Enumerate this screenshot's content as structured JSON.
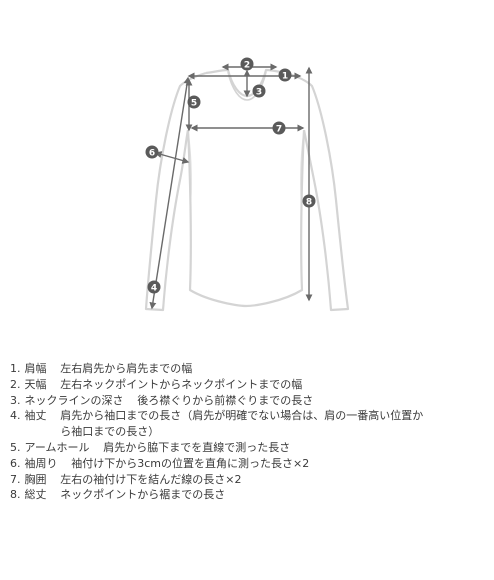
{
  "markers": [
    "1",
    "2",
    "3",
    "4",
    "5",
    "6",
    "7",
    "8"
  ],
  "legend": [
    {
      "num": "1.",
      "term": "肩幅",
      "desc": "左右肩先から肩先までの幅"
    },
    {
      "num": "2.",
      "term": "天幅",
      "desc": "左右ネックポイントからネックポイントまでの幅"
    },
    {
      "num": "3.",
      "term": "ネックラインの深さ",
      "desc": "後ろ襟ぐりから前襟ぐりまでの長さ"
    },
    {
      "num": "4.",
      "term": "袖丈",
      "desc": "肩先から袖口までの長さ（肩先が明確でない場合は、肩の一番高い位置から袖口までの長さ）"
    },
    {
      "num": "5.",
      "term": "アームホール",
      "desc": "肩先から脇下までを直線で測った長さ"
    },
    {
      "num": "6.",
      "term": "袖周り",
      "desc": "袖付け下から3cmの位置を直角に測った長さ×2"
    },
    {
      "num": "7.",
      "term": "胸囲",
      "desc": "左右の袖付け下を結んだ線の長さ×2"
    },
    {
      "num": "8.",
      "term": "総丈",
      "desc": "ネックポイントから裾までの長さ"
    }
  ],
  "colors": {
    "garment": "#d4d4d4",
    "measure": "#6a6a6a",
    "badge": "#5a5a5a",
    "text": "#3a3a3a"
  }
}
